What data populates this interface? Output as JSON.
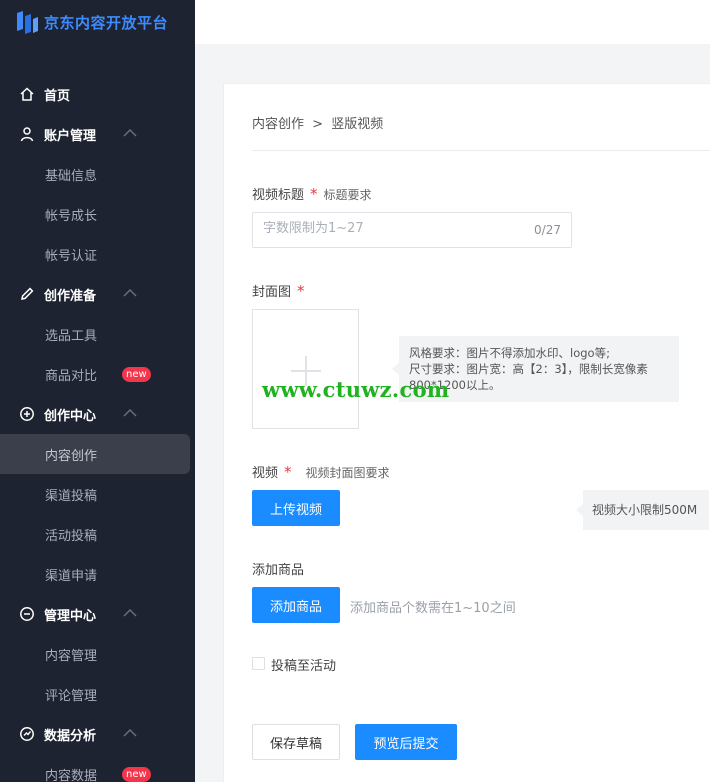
{
  "brand": {
    "name": "京东内容开放平台",
    "color": "#3d8bff"
  },
  "sidebar": {
    "home": "首页",
    "groups": [
      {
        "label": "账户管理",
        "icon": "user-icon",
        "items": [
          "基础信息",
          "帐号成长",
          "帐号认证"
        ]
      },
      {
        "label": "创作准备",
        "icon": "pencil-icon",
        "items": [
          "选品工具",
          "商品对比"
        ]
      },
      {
        "label": "创作中心",
        "icon": "create-icon",
        "items": [
          "内容创作",
          "渠道投稿",
          "活动投稿",
          "渠道申请"
        ]
      },
      {
        "label": "管理中心",
        "icon": "chat-icon",
        "items": [
          "内容管理",
          "评论管理"
        ]
      },
      {
        "label": "数据分析",
        "icon": "analytics-icon",
        "items": [
          "内容数据"
        ]
      }
    ],
    "active_item": "内容创作",
    "badge_new": "new"
  },
  "breadcrumb": {
    "parent": "内容创作",
    "separator": ">",
    "current": "竖版视频"
  },
  "form": {
    "title_label": "视频标题",
    "title_hint": "标题要求",
    "title_placeholder": "字数限制为1~27",
    "title_count": "0/27",
    "cover_label": "封面图",
    "cover_tip_line1": "风格要求：图片不得添加水印、logo等;",
    "cover_tip_line2": "尺寸要求：图片宽：高【2：3】，限制长宽像素800*1200以上。",
    "video_label": "视频",
    "video_hint": "视频封面图要求",
    "upload_button": "上传视频",
    "video_tip": "视频大小限制500M",
    "product_label": "添加商品",
    "add_product_button": "添加商品",
    "product_note": "添加商品个数需在1~10之间",
    "activity_checkbox": "投稿至活动",
    "required_mark": "*",
    "save_draft_button": "保存草稿",
    "preview_submit_button": "预览后提交"
  },
  "watermark": "www.ctuwz.com",
  "colors": {
    "sidebar_bg": "#1d2331",
    "primary": "#1a8cff",
    "required": "#f0343c",
    "badge": "#f4364c"
  }
}
